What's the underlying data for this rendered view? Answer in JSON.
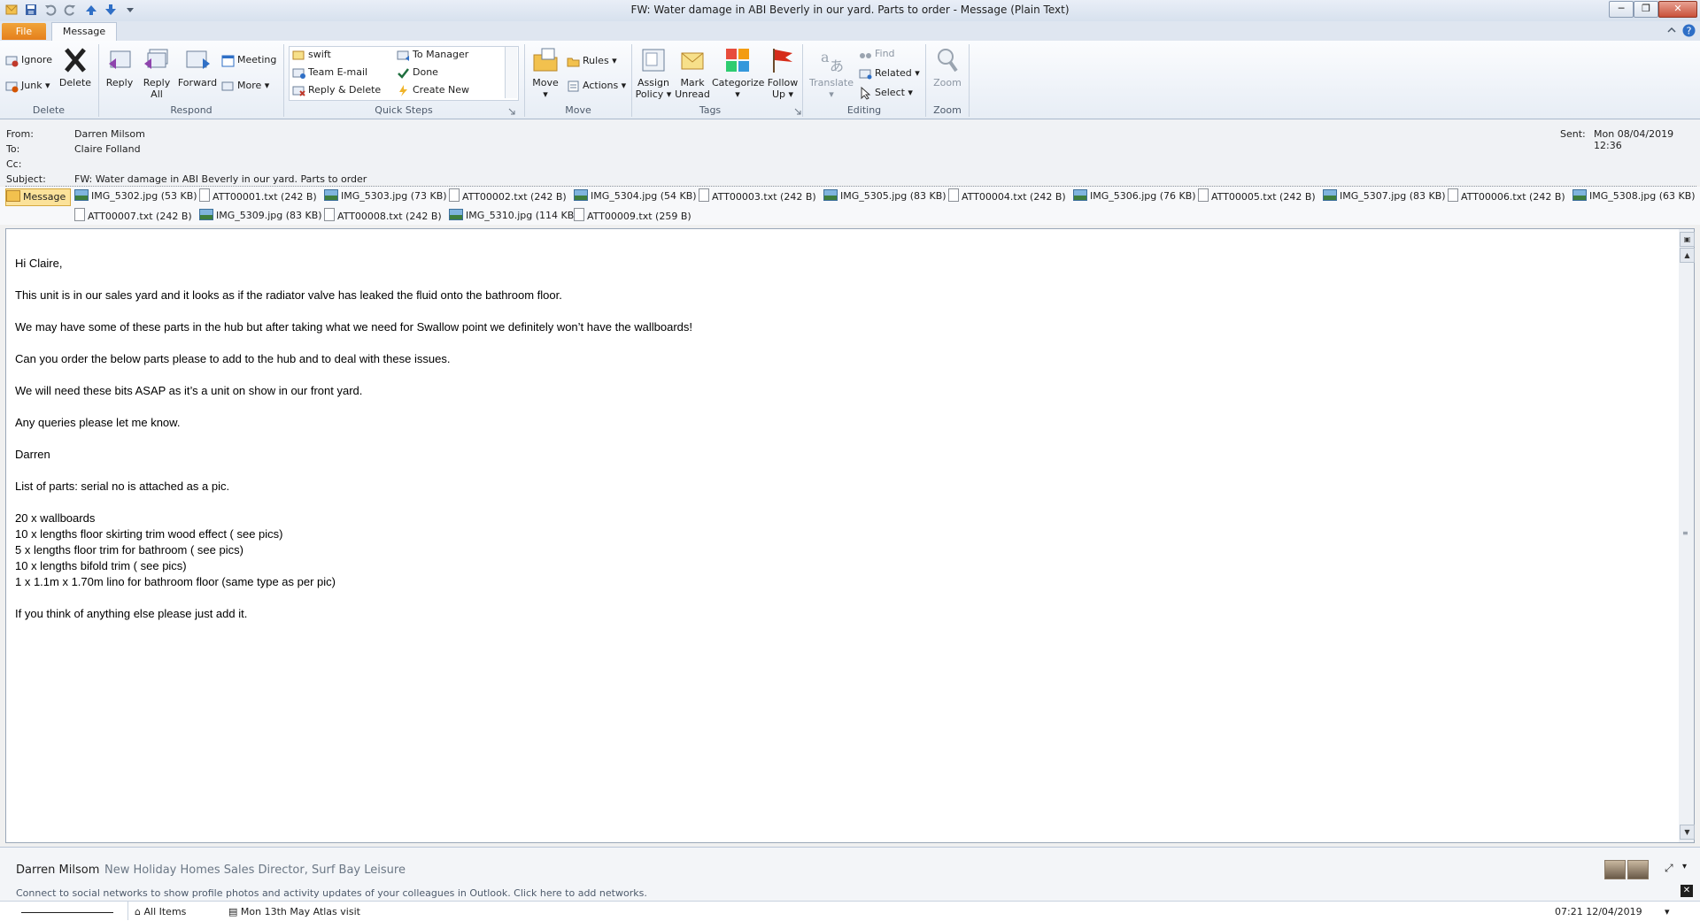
{
  "window": {
    "title": "FW: Water damage in ABI Beverly in our yard. Parts to order  -  Message (Plain Text)",
    "minimize": "─",
    "maximize": "❐",
    "close": "✕"
  },
  "tabs": {
    "file": "File",
    "message": "Message"
  },
  "ribbon": {
    "delete_group": {
      "label": "Delete",
      "ignore": "Ignore",
      "junk": "Junk",
      "delete": "Delete"
    },
    "respond_group": {
      "label": "Respond",
      "reply": "Reply",
      "reply_all": "Reply All",
      "forward": "Forward",
      "meeting": "Meeting",
      "more": "More"
    },
    "quick_steps": {
      "label": "Quick Steps",
      "items": [
        "swift",
        "Team E-mail",
        "Reply & Delete",
        "To Manager",
        "Done",
        "Create New"
      ]
    },
    "move_group": {
      "label": "Move",
      "move": "Move",
      "rules": "Rules",
      "actions": "Actions"
    },
    "tags_group": {
      "label": "Tags",
      "assign_policy": "Assign Policy",
      "mark_unread": "Mark Unread",
      "categorize": "Categorize",
      "follow_up": "Follow Up"
    },
    "editing_group": {
      "label": "Editing",
      "translate": "Translate",
      "find": "Find",
      "related": "Related",
      "select": "Select"
    },
    "zoom_group": {
      "label": "Zoom",
      "zoom": "Zoom"
    }
  },
  "header": {
    "from_label": "From:",
    "from": "Darren Milsom",
    "to_label": "To:",
    "to": "Claire Folland",
    "cc_label": "Cc:",
    "cc": "",
    "subject_label": "Subject:",
    "subject": "FW: Water damage in ABI Beverly in our yard. Parts to order",
    "sent_label": "Sent:",
    "sent": "Mon 08/04/2019 12:36"
  },
  "attachments": {
    "message_tab": "Message",
    "row1": [
      {
        "name": "IMG_5302.jpg (53 KB)",
        "kind": "img"
      },
      {
        "name": "ATT00001.txt (242 B)",
        "kind": "txt"
      },
      {
        "name": "IMG_5303.jpg (73 KB)",
        "kind": "img"
      },
      {
        "name": "ATT00002.txt (242 B)",
        "kind": "txt"
      },
      {
        "name": "IMG_5304.jpg (54 KB)",
        "kind": "img"
      },
      {
        "name": "ATT00003.txt (242 B)",
        "kind": "txt"
      },
      {
        "name": "IMG_5305.jpg (83 KB)",
        "kind": "img"
      },
      {
        "name": "ATT00004.txt (242 B)",
        "kind": "txt"
      },
      {
        "name": "IMG_5306.jpg (76 KB)",
        "kind": "img"
      },
      {
        "name": "ATT00005.txt (242 B)",
        "kind": "txt"
      },
      {
        "name": "IMG_5307.jpg (83 KB)",
        "kind": "img"
      },
      {
        "name": "ATT00006.txt (242 B)",
        "kind": "txt"
      },
      {
        "name": "IMG_5308.jpg (63 KB)",
        "kind": "img"
      }
    ],
    "row2": [
      {
        "name": "ATT00007.txt (242 B)",
        "kind": "txt"
      },
      {
        "name": "IMG_5309.jpg (83 KB)",
        "kind": "img"
      },
      {
        "name": "ATT00008.txt (242 B)",
        "kind": "txt"
      },
      {
        "name": "IMG_5310.jpg (114 KB)",
        "kind": "img"
      },
      {
        "name": "ATT00009.txt (259 B)",
        "kind": "txt"
      }
    ]
  },
  "body": {
    "greeting": "Hi Claire,",
    "p1": "This unit is in our sales yard and it looks as if the radiator valve has leaked the fluid onto the bathroom floor.",
    "p2": "We may have some of these parts in the hub but after taking what we need for Swallow point we definitely won’t have the wallboards!",
    "p3": "Can you order the below parts please to add to the hub and to deal with these issues.",
    "p4": "We will need these bits ASAP as it’s a unit on show in our front yard.",
    "p5": "Any queries please let me know.",
    "sign": "Darren",
    "list_intro": "List of parts: serial no is attached as a pic.",
    "parts": [
      "20 x wallboards",
      "10 x lengths floor skirting trim wood effect ( see pics)",
      "5 x lengths floor trim for bathroom ( see pics)",
      "10 x lengths bifold trim ( see pics)",
      "1 x 1.1m x 1.70m lino for bathroom floor (same type as per pic)"
    ],
    "closing": "If you think of anything else please just add it."
  },
  "people_pane": {
    "name": "Darren Milsom",
    "title": "New Holiday Homes Sales Director, Surf Bay Leisure",
    "social": "Connect to social networks to show profile photos and activity updates of your colleagues in Outlook. Click here to add networks."
  },
  "statusbar": {
    "all_items": "All Items",
    "reminder": "Mon 13th May Atlas visit",
    "time": "07:21  12/04/2019"
  }
}
